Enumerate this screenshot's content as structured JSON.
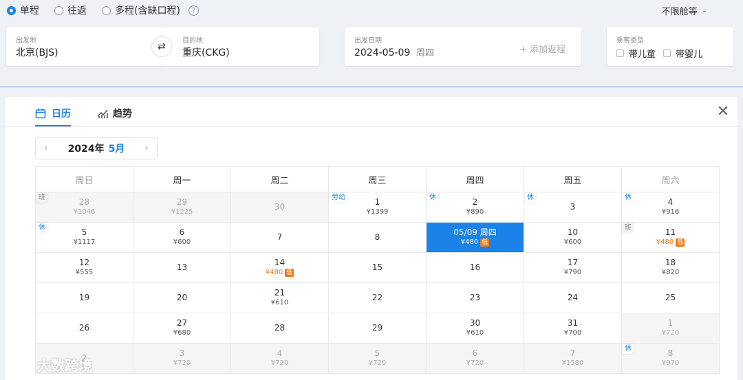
{
  "trip_types": [
    {
      "label": "单程",
      "checked": true
    },
    {
      "label": "往返",
      "checked": false
    },
    {
      "label": "多程(含缺口程)",
      "checked": false
    }
  ],
  "help_glyph": "?",
  "cabin": {
    "label": "不限舱等",
    "chevron": "⌄"
  },
  "route": {
    "from_label": "出发地",
    "from_value": "北京(BJS)",
    "to_label": "目的地",
    "to_value": "重庆(CKG)",
    "swap_glyph": "⇄"
  },
  "date": {
    "label": "出发日期",
    "value": "2024-05-09",
    "weekday": "周四",
    "add_return": "+ 添加返程"
  },
  "passenger": {
    "label": "乘客类型",
    "options": [
      "带儿童",
      "带婴儿"
    ]
  },
  "tabs": {
    "calendar": "日历",
    "trend": "趋势"
  },
  "close_glyph": "✕",
  "month_nav": {
    "year": "2024年",
    "month": "5月",
    "prev": "‹",
    "next": "›"
  },
  "weekdays": [
    "周日",
    "周一",
    "周二",
    "周三",
    "周四",
    "周五",
    "周六"
  ],
  "low_tag": "低",
  "weeks": [
    [
      {
        "day": "28",
        "price": "¥1046",
        "other": true,
        "badge": "班",
        "badge_type": "work"
      },
      {
        "day": "29",
        "price": "¥1225",
        "other": true
      },
      {
        "day": "30",
        "price": "",
        "other": true
      },
      {
        "day": "1",
        "price": "¥1399",
        "badge": "劳动",
        "badge_type": "holiday"
      },
      {
        "day": "2",
        "price": "¥890",
        "badge": "休",
        "badge_type": "holiday"
      },
      {
        "day": "3",
        "price": "",
        "badge": "休",
        "badge_type": "holiday"
      },
      {
        "day": "4",
        "price": "¥916",
        "badge": "休",
        "badge_type": "holiday"
      }
    ],
    [
      {
        "day": "5",
        "price": "¥1117",
        "badge": "休",
        "badge_type": "holiday"
      },
      {
        "day": "6",
        "price": "¥600"
      },
      {
        "day": "7",
        "price": ""
      },
      {
        "day": "8",
        "price": ""
      },
      {
        "day": "05/09 周四",
        "price": "¥480",
        "low": true,
        "selected": true
      },
      {
        "day": "10",
        "price": "¥600"
      },
      {
        "day": "11",
        "price": "¥480",
        "low": true,
        "badge": "班",
        "badge_type": "work"
      }
    ],
    [
      {
        "day": "12",
        "price": "¥555"
      },
      {
        "day": "13",
        "price": ""
      },
      {
        "day": "14",
        "price": "¥480",
        "low": true
      },
      {
        "day": "15",
        "price": ""
      },
      {
        "day": "16",
        "price": ""
      },
      {
        "day": "17",
        "price": "¥790"
      },
      {
        "day": "18",
        "price": "¥820"
      }
    ],
    [
      {
        "day": "19",
        "price": ""
      },
      {
        "day": "20",
        "price": ""
      },
      {
        "day": "21",
        "price": "¥610"
      },
      {
        "day": "22",
        "price": ""
      },
      {
        "day": "23",
        "price": ""
      },
      {
        "day": "24",
        "price": ""
      },
      {
        "day": "25",
        "price": ""
      }
    ],
    [
      {
        "day": "26",
        "price": ""
      },
      {
        "day": "27",
        "price": "¥680"
      },
      {
        "day": "28",
        "price": ""
      },
      {
        "day": "29",
        "price": ""
      },
      {
        "day": "30",
        "price": "¥610"
      },
      {
        "day": "31",
        "price": "¥700"
      },
      {
        "day": "1",
        "price": "¥720",
        "other": true
      }
    ],
    [
      {
        "day": "2",
        "price": "",
        "other": true
      },
      {
        "day": "3",
        "price": "¥720",
        "other": true
      },
      {
        "day": "4",
        "price": "¥720",
        "other": true
      },
      {
        "day": "5",
        "price": "¥720",
        "other": true
      },
      {
        "day": "6",
        "price": "¥720",
        "other": true
      },
      {
        "day": "7",
        "price": "¥1580",
        "other": true
      },
      {
        "day": "8",
        "price": "¥970",
        "other": true,
        "badge": "休",
        "badge_type": "holiday"
      }
    ]
  ],
  "watermark": "大数跨境",
  "colors": {
    "accent": "#1a82e8",
    "low_price": "#f07b14"
  }
}
